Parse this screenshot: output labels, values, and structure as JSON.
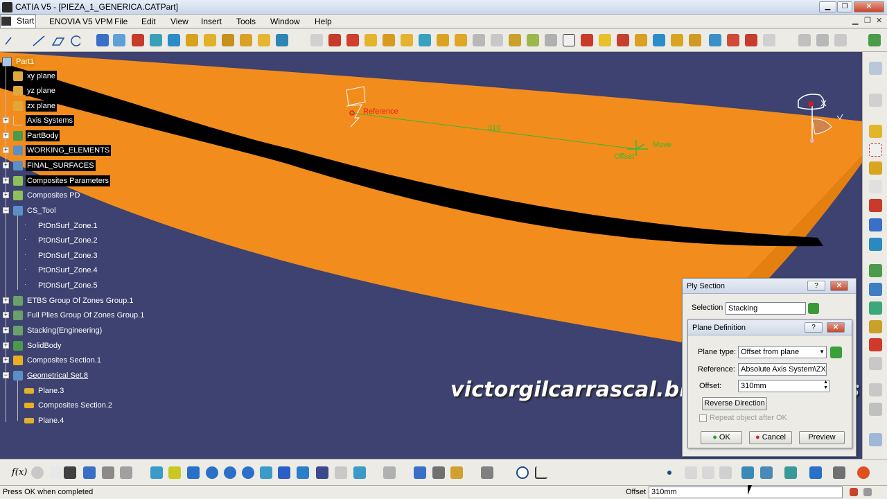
{
  "window": {
    "title": "CATIA V5 - [PIEZA_1_GENERICA.CATPart]",
    "minimize": "▁",
    "restore": "❐",
    "close": "✕"
  },
  "menu": {
    "start": "Start",
    "items": [
      "ENOVIA V5 VPM",
      "File",
      "Edit",
      "View",
      "Insert",
      "Tools",
      "Window",
      "Help"
    ]
  },
  "tree": {
    "nodes": [
      {
        "label": "Part1",
        "icon": "part-icon"
      },
      {
        "label": "xy plane",
        "icon": "plane-icon"
      },
      {
        "label": "yz plane",
        "icon": "plane-icon"
      },
      {
        "label": "zx plane",
        "icon": "plane-icon"
      },
      {
        "label": "Axis Systems",
        "icon": "axis-icon"
      },
      {
        "label": "PartBody",
        "icon": "body-icon"
      },
      {
        "label": "WORKING_ELEMENTS",
        "icon": "geoset-icon"
      },
      {
        "label": "FINAL_SURFACES",
        "icon": "geoset-icon"
      },
      {
        "label": "Composites Parameters",
        "icon": "composites-icon"
      },
      {
        "label": "Composites PD",
        "icon": "composites-icon"
      },
      {
        "label": "CS_Tool",
        "icon": "geoset-icon"
      },
      {
        "label": "PtOnSurf_Zone.1",
        "icon": "point-icon"
      },
      {
        "label": "PtOnSurf_Zone.2",
        "icon": "point-icon"
      },
      {
        "label": "PtOnSurf_Zone.3",
        "icon": "point-icon"
      },
      {
        "label": "PtOnSurf_Zone.4",
        "icon": "point-icon"
      },
      {
        "label": "PtOnSurf_Zone.5",
        "icon": "point-icon"
      },
      {
        "label": "ETBS Group Of Zones Group.1",
        "icon": "zones-icon"
      },
      {
        "label": "Full Plies Group Of Zones Group.1",
        "icon": "zones-icon"
      },
      {
        "label": "Stacking(Engineering)",
        "icon": "stacking-icon"
      },
      {
        "label": "SolidBody",
        "icon": "body-icon"
      },
      {
        "label": "Composites Section.1",
        "icon": "section-icon"
      },
      {
        "label": "Geometrical Set.8",
        "icon": "geoset-icon"
      },
      {
        "label": "Plane.3",
        "icon": "plane-icon"
      },
      {
        "label": "Composites Section.2",
        "icon": "section-icon"
      },
      {
        "label": "Plane.4",
        "icon": "plane-icon"
      }
    ]
  },
  "scene": {
    "reference_label": "Reference",
    "distance_label": "310",
    "move_label": "Move",
    "offset_label": "Offset"
  },
  "watermark": "victorgilcarrascal.blogspot.com.es",
  "ply_section": {
    "title": "Ply Section",
    "help": "?",
    "close": "✕",
    "selection_label": "Selection",
    "selection_value": "Stacking"
  },
  "plane_definition": {
    "title": "Plane Definition",
    "help": "?",
    "close": "✕",
    "plane_type_label": "Plane type:",
    "plane_type_value": "Offset from plane",
    "reference_label": "Reference:",
    "reference_value": "Absolute Axis System\\ZX",
    "offset_label": "Offset:",
    "offset_value": "310mm",
    "reverse_button": "Reverse Direction",
    "repeat_checkbox": "Repeat object after OK",
    "ok": "OK",
    "cancel": "Cancel",
    "preview": "Preview"
  },
  "status": {
    "message": "Press OK when completed",
    "offset_label": "Offset",
    "offset_value": "310mm"
  },
  "colors": {
    "viewport_bg": "#3d4270",
    "surface": "#f28c1d",
    "stripe": "#000000",
    "accent_green": "#2ebd2e",
    "reference_red": "#e0201a"
  }
}
